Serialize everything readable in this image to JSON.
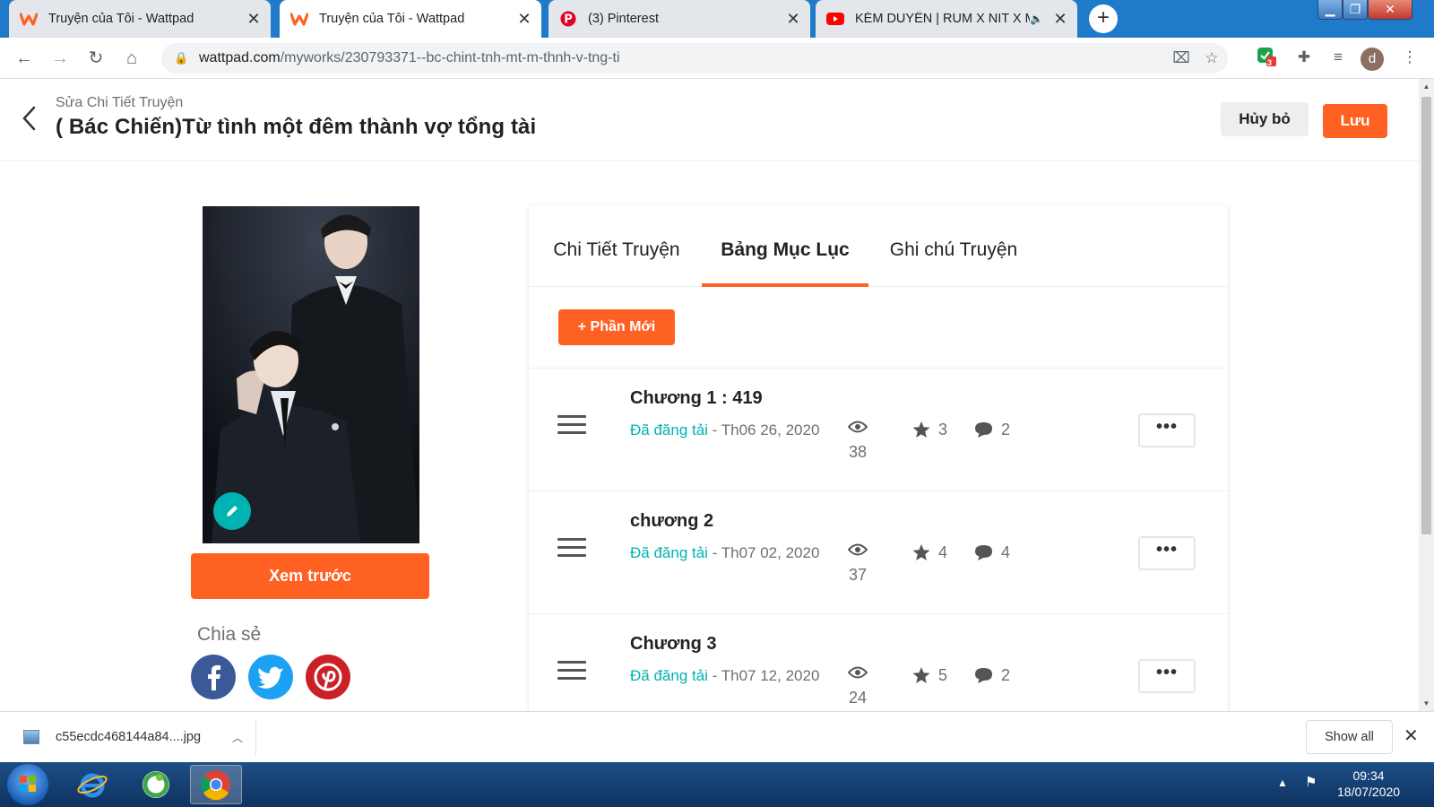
{
  "browser": {
    "tabs": [
      {
        "title": "Truyện của Tôi - Wattpad",
        "favicon": "wattpad-icon",
        "active": false
      },
      {
        "title": "Truyện của Tôi - Wattpad",
        "favicon": "wattpad-icon",
        "active": true
      },
      {
        "title": "(3) Pinterest",
        "favicon": "pinterest-icon",
        "active": false
      },
      {
        "title": "KÉM DUYÊN | RUM X NIT X M",
        "favicon": "youtube-icon",
        "active": false
      }
    ],
    "url_domain": "wattpad.com",
    "url_path": "/myworks/230793371--bc-chint-tnh-mt-m-thnh-v-tng-ti",
    "extension_badge": "3",
    "profile_initial": "d"
  },
  "header": {
    "subtitle": "Sửa Chi Tiết Truyện",
    "title": "( Bác Chiến)Từ tình một đêm thành vợ tổng tài",
    "cancel_label": "Hủy bỏ",
    "save_label": "Lưu"
  },
  "sidebar": {
    "preview_label": "Xem trước",
    "share_label": "Chia sẻ",
    "share_networks": [
      "facebook",
      "twitter",
      "pinterest"
    ]
  },
  "tabs": [
    {
      "label": "Chi Tiết Truyện",
      "active": false
    },
    {
      "label": "Bảng Mục Lục",
      "active": true
    },
    {
      "label": "Ghi chú Truyện",
      "active": false
    }
  ],
  "new_part_label": "+ Phần Mới",
  "parts": [
    {
      "title": "Chương 1 : 419",
      "status": "Đã đăng tải",
      "date": " - Th06 26, 2020",
      "views": "38",
      "votes": "3",
      "comments": "2"
    },
    {
      "title": "chương 2",
      "status": "Đã đăng tải",
      "date": " - Th07 02, 2020",
      "views": "37",
      "votes": "4",
      "comments": "4"
    },
    {
      "title": "Chương 3",
      "status": "Đã đăng tải",
      "date": " - Th07 12, 2020",
      "views": "24",
      "votes": "5",
      "comments": "2"
    }
  ],
  "download": {
    "filename": "c55ecdc468144a84....jpg",
    "show_all_label": "Show all"
  },
  "taskbar": {
    "time": "09:34",
    "date": "18/07/2020"
  },
  "colors": {
    "accent": "#ff6122",
    "teal": "#00b2b2"
  }
}
